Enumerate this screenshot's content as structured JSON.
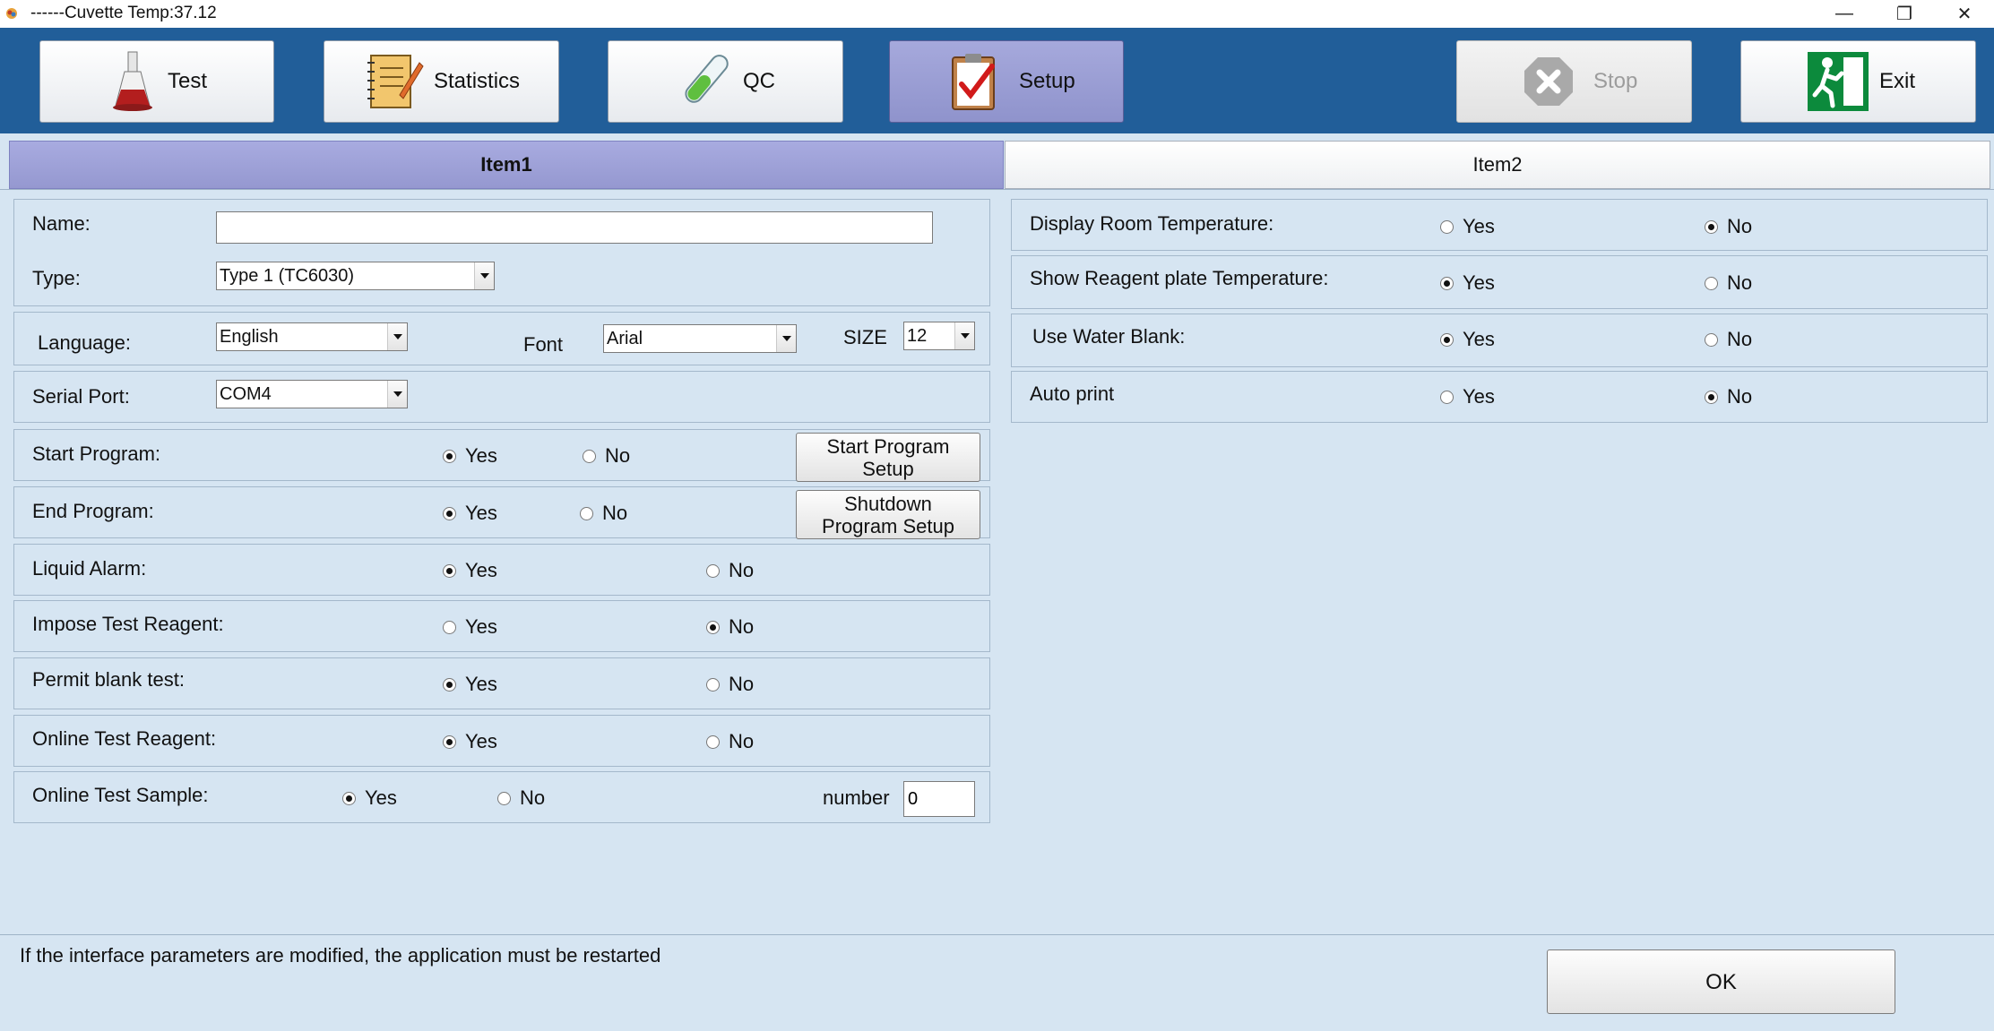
{
  "window": {
    "title": "------Cuvette Temp:37.12",
    "min_glyph": "—",
    "max_glyph": "❐",
    "close_glyph": "✕"
  },
  "toolbar": {
    "test_label": "Test",
    "statistics_label": "Statistics",
    "qc_label": "QC",
    "setup_label": "Setup",
    "stop_label": "Stop",
    "exit_label": "Exit"
  },
  "tabs": {
    "item1": "Item1",
    "item2": "Item2"
  },
  "left": {
    "name_label": "Name:",
    "name_value": "",
    "type_label": "Type:",
    "type_value": "Type 1 (TC6030)",
    "language_label": "Language:",
    "language_value": "English",
    "font_label": "Font",
    "font_value": "Arial",
    "size_label": "SIZE",
    "size_value": "12",
    "serial_label": "Serial Port:",
    "serial_value": "COM4",
    "rows": [
      {
        "label": "Start Program:",
        "yes": "Yes",
        "no": "No",
        "selected": "yes"
      },
      {
        "label": "End Program:",
        "yes": "Yes",
        "no": "No",
        "selected": "yes"
      },
      {
        "label": "Liquid Alarm:",
        "yes": "Yes",
        "no": "No",
        "selected": "yes"
      },
      {
        "label": "Impose Test Reagent:",
        "yes": "Yes",
        "no": "No",
        "selected": "no"
      },
      {
        "label": "Permit blank test:",
        "yes": "Yes",
        "no": "No",
        "selected": "yes"
      },
      {
        "label": "Online Test Reagent:",
        "yes": "Yes",
        "no": "No",
        "selected": "yes"
      },
      {
        "label": "Online Test Sample:",
        "yes": "Yes",
        "no": "No",
        "selected": "yes"
      }
    ],
    "start_setup_l1": "Start Program",
    "start_setup_l2": "Setup",
    "shutdown_setup_l1": "Shutdown",
    "shutdown_setup_l2": "Program Setup",
    "number_label": "number",
    "number_value": "0"
  },
  "right": {
    "rows": [
      {
        "label": "Display Room Temperature:",
        "yes": "Yes",
        "no": "No",
        "selected": "no"
      },
      {
        "label": "Show Reagent plate Temperature:",
        "yes": "Yes",
        "no": "No",
        "selected": "yes"
      },
      {
        "label": "Use Water Blank:",
        "yes": "Yes",
        "no": "No",
        "selected": "yes"
      },
      {
        "label": "Auto print",
        "yes": "Yes",
        "no": "No",
        "selected": "no"
      }
    ]
  },
  "footer": {
    "notice": "If the interface parameters are modified, the application must be restarted",
    "ok_label": "OK"
  },
  "colors": {
    "toolbar": "#215e99",
    "active_tab": "#9fa2da",
    "panel_bg": "#d6e5f2"
  }
}
